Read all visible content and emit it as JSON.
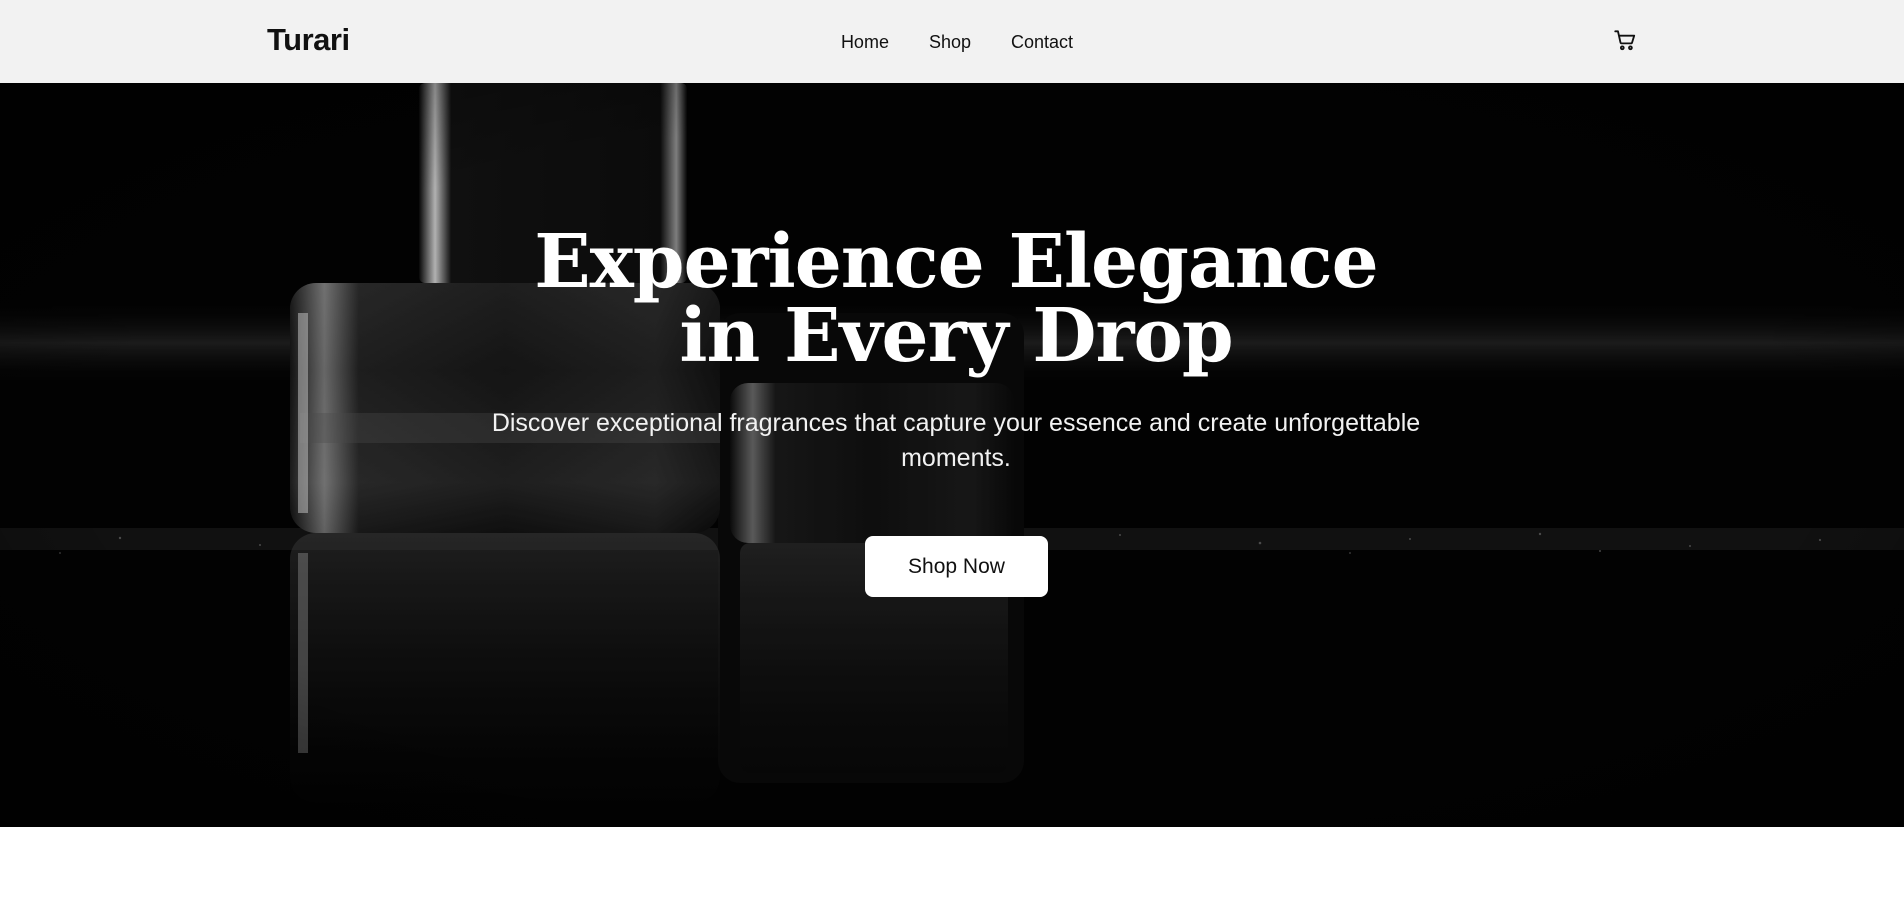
{
  "header": {
    "brand": "Turari",
    "nav": [
      {
        "label": "Home"
      },
      {
        "label": "Shop"
      },
      {
        "label": "Contact"
      }
    ],
    "cart_icon": "shopping-cart-icon"
  },
  "hero": {
    "title_line1": "Experience Elegance",
    "title_line2": "in Every Drop",
    "subtitle": "Discover exceptional fragrances that capture your essence and create unforgettable moments.",
    "cta_label": "Shop Now",
    "background_image": "black-and-white perfume bottles photo"
  },
  "colors": {
    "header_bg": "#f2f2f2",
    "hero_bg": "#030303",
    "text_dark": "#111111",
    "text_light": "#ffffff",
    "button_bg": "#ffffff"
  }
}
